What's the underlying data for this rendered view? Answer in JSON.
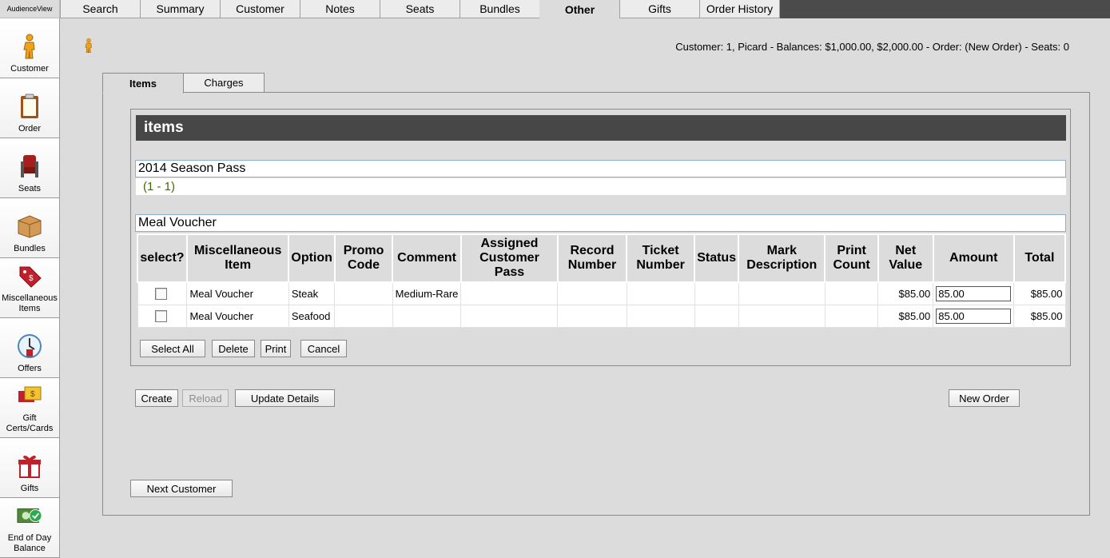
{
  "brand": "AudienceView",
  "top_tabs": [
    {
      "label": "Search"
    },
    {
      "label": "Summary"
    },
    {
      "label": "Customer"
    },
    {
      "label": "Notes"
    },
    {
      "label": "Seats"
    },
    {
      "label": "Bundles"
    },
    {
      "label": "Other",
      "active": true
    },
    {
      "label": "Gifts"
    },
    {
      "label": "Order History"
    }
  ],
  "sidebar": {
    "items": [
      {
        "label": "Customer",
        "icon": "person-icon"
      },
      {
        "label": "Order",
        "icon": "clipboard-icon"
      },
      {
        "label": "Seats",
        "icon": "seat-icon"
      },
      {
        "label": "Bundles",
        "icon": "box-icon"
      },
      {
        "label": "Miscellaneous Items",
        "icon": "price-tag-icon"
      },
      {
        "label": "Offers",
        "icon": "clock-icon"
      },
      {
        "label": "Gift Certs/Cards",
        "icon": "gift-card-icon"
      },
      {
        "label": "Gifts",
        "icon": "gift-icon"
      },
      {
        "label": "End of Day Balance",
        "icon": "cash-check-icon"
      }
    ]
  },
  "customer_info": "Customer: 1, Picard - Balances: $1,000.00, $2,000.00 - Order: (New Order) - Seats: 0",
  "sub_tabs": [
    {
      "label": "Items",
      "active": true
    },
    {
      "label": "Charges"
    }
  ],
  "items_section": {
    "header": "items",
    "pass_group": {
      "title": "2014 Season Pass",
      "range": "(1 - 1)"
    },
    "voucher_group": {
      "title": "Meal Voucher"
    },
    "columns": [
      "select?",
      "Miscellaneous Item",
      "Option",
      "Promo Code",
      "Comment",
      "Assigned Customer Pass",
      "Record Number",
      "Ticket Number",
      "Status",
      "Mark Description",
      "Print Count",
      "Net Value",
      "Amount",
      "Total"
    ],
    "rows": [
      {
        "item": "Meal Voucher",
        "option": "Steak",
        "promo": "",
        "comment": "Medium-Rare",
        "pass": "",
        "record": "",
        "ticket": "",
        "status": "",
        "mark": "",
        "print": "",
        "net": "$85.00",
        "amount": "85.00",
        "total": "$85.00"
      },
      {
        "item": "Meal Voucher",
        "option": "Seafood",
        "promo": "",
        "comment": "",
        "pass": "",
        "record": "",
        "ticket": "",
        "status": "",
        "mark": "",
        "print": "",
        "net": "$85.00",
        "amount": "85.00",
        "total": "$85.00"
      }
    ],
    "buttons": {
      "select_all": "Select All",
      "delete": "Delete",
      "print": "Print",
      "cancel": "Cancel"
    }
  },
  "actions": {
    "create": "Create",
    "reload": "Reload",
    "update_details": "Update Details",
    "new_order": "New Order",
    "next_customer": "Next Customer"
  },
  "colors": {
    "header_dark": "#474747",
    "top_bar": "#4b4b4b",
    "background": "#dcdcdc",
    "range_green": "#3e6b00"
  }
}
